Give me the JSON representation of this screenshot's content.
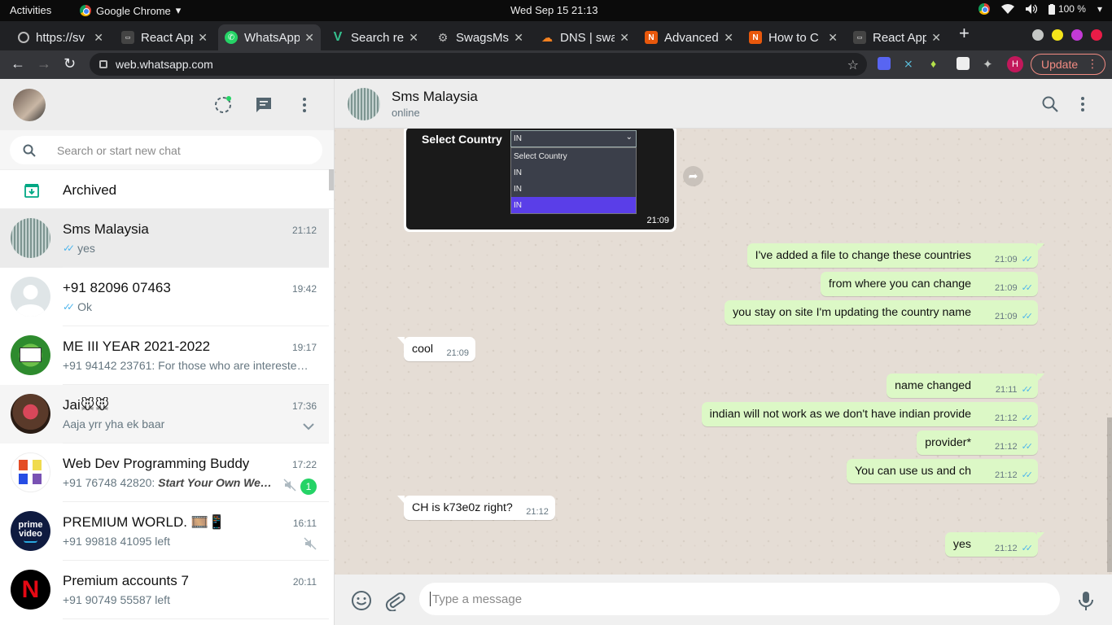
{
  "os_bar": {
    "activities": "Activities",
    "app_name": "Google Chrome",
    "clock": "Wed Sep 15  21:13",
    "battery": "100 %"
  },
  "browser": {
    "tabs": [
      {
        "label": "https://sv"
      },
      {
        "label": "React App"
      },
      {
        "label": "WhatsApp"
      },
      {
        "label": "Search re"
      },
      {
        "label": "SwagsMs"
      },
      {
        "label": "DNS | swa"
      },
      {
        "label": "Advanced"
      },
      {
        "label": "How to C"
      },
      {
        "label": "React App"
      }
    ],
    "new_tab": "+",
    "url": "web.whatsapp.com",
    "profile_initial": "H",
    "update_label": "Update"
  },
  "sidebar": {
    "search_placeholder": "Search or start new chat",
    "archived_label": "Archived",
    "chats": [
      {
        "name": "Sms Malaysia",
        "time": "21:12",
        "preview": "yes",
        "ticks": true
      },
      {
        "name": "+91 82096 07463",
        "time": "19:42",
        "preview": "Ok",
        "ticks": true
      },
      {
        "name": "ME III YEAR 2021-2022",
        "time": "19:17",
        "preview": "+91 94142 23761: For those who are intereste…"
      },
      {
        "name": "Jai🐭🐭",
        "time": "17:36",
        "preview": "Aaja yrr yha ek baar"
      },
      {
        "name": "Web Dev Programming Buddy",
        "time": "17:22",
        "preview_prefix": "+91 76748 42820: ",
        "preview_bold": "Start Your Own We…",
        "unread": "1",
        "muted": true
      },
      {
        "name": "PREMIUM WORLD. 🎞️📱",
        "time": "16:11",
        "preview": "+91 99818 41095 left",
        "muted": true
      },
      {
        "name": "Premium accounts 7",
        "time": "20:11",
        "preview": "+91 90749 55587 left"
      }
    ]
  },
  "conversation": {
    "contact_name": "Sms Malaysia",
    "status": "online",
    "image_message": {
      "label": "Select Country",
      "selected": "IN",
      "options": [
        "Select Country",
        "IN",
        "IN",
        "IN"
      ],
      "time": "21:09"
    },
    "messages": [
      {
        "dir": "out",
        "text": "I've added a file to change these countries",
        "time": "21:09"
      },
      {
        "dir": "out",
        "text": "from where you can change",
        "time": "21:09"
      },
      {
        "dir": "out",
        "text": "you stay on site I'm updating the country name",
        "time": "21:09"
      },
      {
        "dir": "in",
        "text": "cool",
        "time": "21:09"
      },
      {
        "dir": "out",
        "text": "name changed",
        "time": "21:11"
      },
      {
        "dir": "out",
        "text": "indian will not work as we don't have indian provide",
        "time": "21:12"
      },
      {
        "dir": "out",
        "text": "provider*",
        "time": "21:12"
      },
      {
        "dir": "out",
        "text": "You can use us and ch",
        "time": "21:12"
      },
      {
        "dir": "in",
        "text": "CH is k73e0z right?",
        "time": "21:12"
      },
      {
        "dir": "out",
        "text": "yes",
        "time": "21:12"
      }
    ],
    "composer_placeholder": "Type a message"
  },
  "colors": {
    "outgoing_bubble": "#dcf8c6",
    "wallpaper": "#e5ddd5",
    "accent_green": "#25d366",
    "read_ticks": "#4fb6ec"
  }
}
